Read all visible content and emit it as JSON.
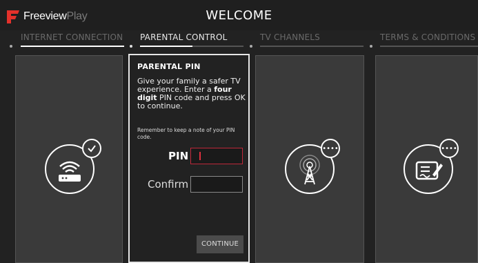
{
  "brand": {
    "name_part1": "Freeview",
    "name_part2": "Play"
  },
  "header": {
    "title": "WELCOME"
  },
  "steps": [
    {
      "label": "INTERNET CONNECTION"
    },
    {
      "label": "PARENTAL CONTROL"
    },
    {
      "label": "TV CHANNELS"
    },
    {
      "label": "TERMS & CONDITIONS"
    }
  ],
  "pin_panel": {
    "title": "PARENTAL PIN",
    "desc_pre": "Give your family a safer TV experience. Enter a ",
    "desc_bold": "four digit",
    "desc_post": " PIN code and press OK to continue.",
    "note": "Remember to keep a note of your PIN code.",
    "pin_label": "PIN",
    "pin_value": "",
    "confirm_label": "Confirm",
    "confirm_value": "",
    "continue_label": "CONTINUE"
  },
  "icons": {
    "internet": "router-wifi-icon",
    "internet_badge": "check-icon",
    "channels": "antenna-tower-icon",
    "channels_badge": "more-dots-icon",
    "terms": "signed-document-icon",
    "terms_badge": "more-dots-icon"
  },
  "colors": {
    "accent": "#c0283a",
    "logo_red": "#e4312b"
  }
}
